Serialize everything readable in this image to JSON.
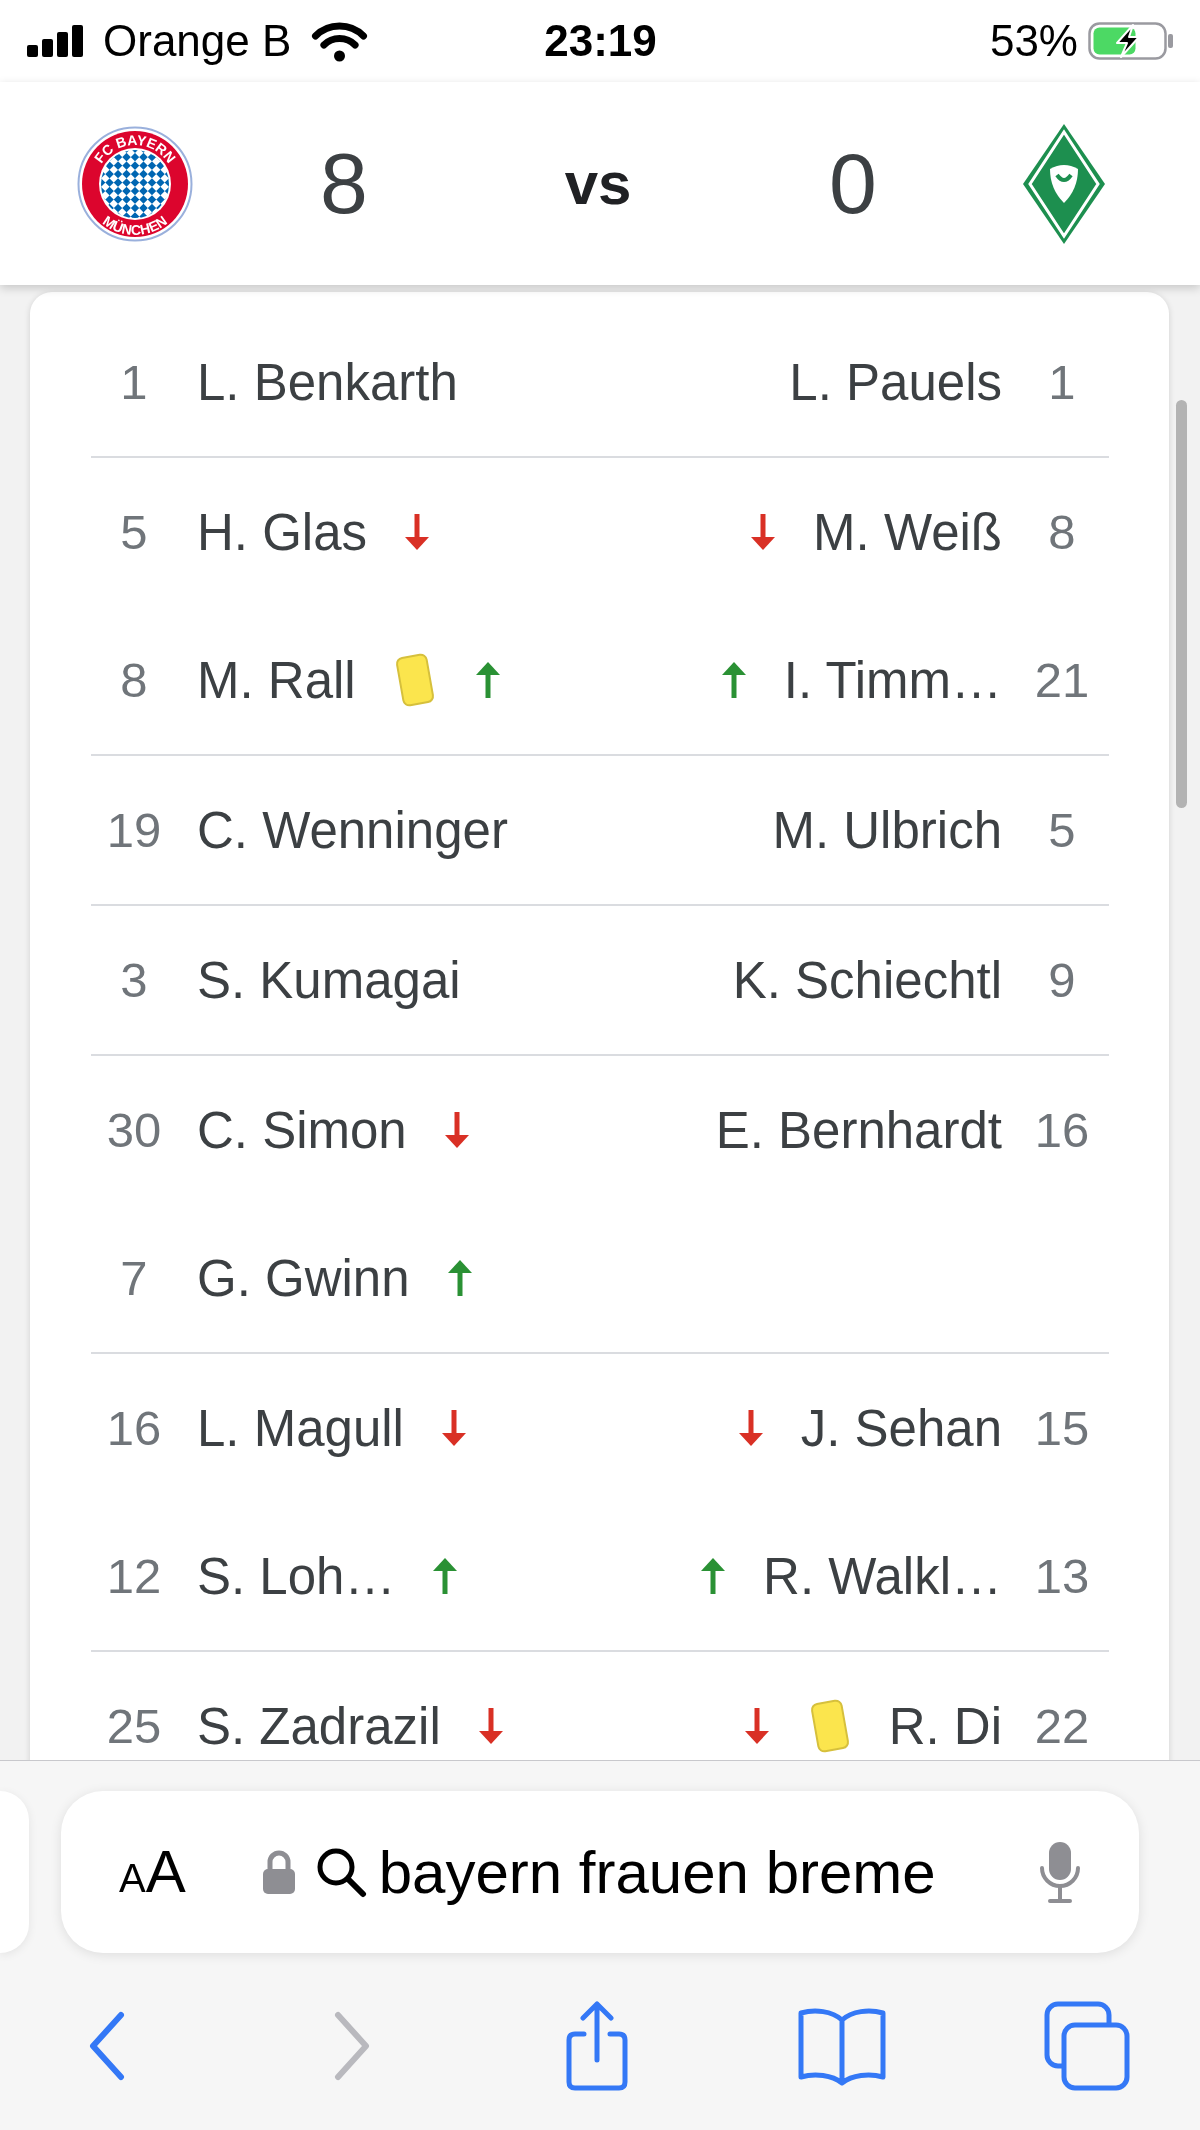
{
  "status_bar": {
    "carrier": "Orange B",
    "time": "23:19",
    "battery": "53%"
  },
  "scoreboard": {
    "home": {
      "crest": {
        "kind": "roundel",
        "top_text": "FC BAYERN",
        "bottom_text": "MÜNCHEN"
      },
      "score": "8"
    },
    "separator": "vs",
    "away": {
      "crest": {
        "kind": "diamond"
      },
      "score": "0"
    }
  },
  "lineup": {
    "groups": [
      {
        "rows": [
          {
            "home": {
              "number": "1",
              "name": "L. Benkarth"
            },
            "away": {
              "number": "1",
              "name": "L. Pauels"
            }
          }
        ]
      },
      {
        "rows": [
          {
            "home": {
              "number": "5",
              "name": "H. Glas",
              "events": [
                {
                  "kind": "sub_off"
                }
              ]
            },
            "away": {
              "number": "8",
              "name": "M. Weiß",
              "events": [
                {
                  "kind": "sub_off"
                }
              ]
            }
          },
          {
            "home": {
              "number": "8",
              "name": "M. Rall",
              "events": [
                {
                  "kind": "yellow_card"
                },
                {
                  "kind": "sub_on"
                }
              ]
            },
            "away": {
              "number": "21",
              "name": "I. Timm…",
              "events": [
                {
                  "kind": "sub_on"
                }
              ]
            }
          }
        ]
      },
      {
        "rows": [
          {
            "home": {
              "number": "19",
              "name": "C. Wenninger"
            },
            "away": {
              "number": "5",
              "name": "M. Ulbrich"
            }
          }
        ]
      },
      {
        "rows": [
          {
            "home": {
              "number": "3",
              "name": "S. Kumagai"
            },
            "away": {
              "number": "9",
              "name": "K. Schiechtl"
            }
          }
        ]
      },
      {
        "rows": [
          {
            "home": {
              "number": "30",
              "name": "C. Simon",
              "events": [
                {
                  "kind": "sub_off"
                }
              ]
            },
            "away": {
              "number": "16",
              "name": "E. Bernhardt"
            }
          },
          {
            "home": {
              "number": "7",
              "name": "G. Gwinn",
              "events": [
                {
                  "kind": "sub_on"
                }
              ]
            }
          }
        ]
      },
      {
        "rows": [
          {
            "home": {
              "number": "16",
              "name": "L. Magull",
              "events": [
                {
                  "kind": "sub_off"
                }
              ]
            },
            "away": {
              "number": "15",
              "name": "J. Sehan",
              "events": [
                {
                  "kind": "sub_off"
                }
              ]
            }
          },
          {
            "home": {
              "number": "12",
              "name": "S. Loh…",
              "events": [
                {
                  "kind": "sub_on"
                }
              ]
            },
            "away": {
              "number": "13",
              "name": "R. Walkl…",
              "events": [
                {
                  "kind": "sub_on"
                }
              ]
            }
          }
        ]
      },
      {
        "rows": [
          {
            "home": {
              "number": "25",
              "name": "S. Zadrazil",
              "events": [
                {
                  "kind": "sub_off"
                }
              ]
            },
            "away": {
              "number": "22",
              "name": "R. Di",
              "events": [
                {
                  "kind": "sub_off"
                },
                {
                  "kind": "yellow_card"
                }
              ]
            }
          }
        ]
      }
    ]
  },
  "toolbar": {
    "text_size_button": "AA",
    "address": "bayern frauen breme",
    "buttons": [
      {
        "kind": "back",
        "disabled": false
      },
      {
        "kind": "forward",
        "disabled": true
      },
      {
        "kind": "share",
        "disabled": false
      },
      {
        "kind": "bookmarks",
        "disabled": false
      },
      {
        "kind": "tabs",
        "disabled": false
      }
    ]
  }
}
